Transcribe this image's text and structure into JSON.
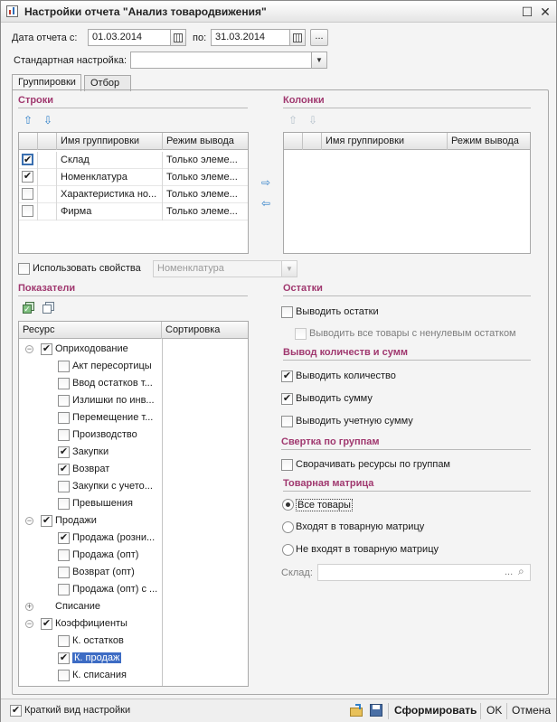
{
  "window": {
    "title": "Настройки отчета \"Анализ товародвижения\"",
    "maximize_glyph": "☐",
    "close_glyph": "✕"
  },
  "period": {
    "from_label": "Дата отчета с:",
    "from_value": "01.03.2014",
    "to_label": "по:",
    "to_value": "31.03.2014",
    "choose_label": "..."
  },
  "standard": {
    "label": "Стандартная настройка:",
    "value": ""
  },
  "tabs": [
    {
      "label": "Группировки"
    },
    {
      "label": "Отбор"
    }
  ],
  "rows_section": {
    "title": "Строки",
    "columns": [
      "Имя группировки",
      "Режим вывода"
    ],
    "items": [
      {
        "checked": "✔",
        "name": "Склад",
        "mode": "Только элеме..."
      },
      {
        "checked": "✔",
        "name": "Номенклатура",
        "mode": "Только элеме..."
      },
      {
        "checked": "",
        "name": "Характеристика но...",
        "mode": "Только элеме..."
      },
      {
        "checked": "",
        "name": "Фирма",
        "mode": "Только элеме..."
      }
    ]
  },
  "columns_section": {
    "title": "Колонки",
    "columns": [
      "Имя группировки",
      "Режим вывода"
    ]
  },
  "use_props": {
    "label": "Использовать свойства",
    "value": "Номенклатура"
  },
  "indicators": {
    "title": "Показатели",
    "columns": [
      "Ресурс",
      "Сортировка"
    ],
    "tree": [
      {
        "toggle": "−",
        "checked": "✔",
        "label": "Оприходование",
        "level": 0
      },
      {
        "checked": "",
        "label": "Акт пересортицы",
        "level": 1
      },
      {
        "checked": "",
        "label": "Ввод остатков т...",
        "level": 1
      },
      {
        "checked": "",
        "label": "Излишки по инв...",
        "level": 1
      },
      {
        "checked": "",
        "label": "Перемещение т...",
        "level": 1
      },
      {
        "checked": "",
        "label": "Производство",
        "level": 1
      },
      {
        "checked": "✔",
        "label": "Закупки",
        "level": 1
      },
      {
        "checked": "✔",
        "label": "Возврат",
        "level": 1
      },
      {
        "checked": "",
        "label": "Закупки с учето...",
        "level": 1
      },
      {
        "checked": "",
        "label": "Превышения",
        "level": 1
      },
      {
        "toggle": "−",
        "checked": "✔",
        "label": "Продажи",
        "level": 0
      },
      {
        "checked": "✔",
        "label": "Продажа (розни...",
        "level": 1
      },
      {
        "checked": "",
        "label": "Продажа (опт)",
        "level": 1
      },
      {
        "checked": "",
        "label": "Возврат (опт)",
        "level": 1
      },
      {
        "checked": "",
        "label": "Продажа (опт) с ...",
        "level": 1
      },
      {
        "toggle": "+",
        "label": "Списание",
        "level": 0
      },
      {
        "toggle": "−",
        "checked": "✔",
        "label": "Коэффициенты",
        "level": 0
      },
      {
        "checked": "",
        "label": "К. остатков",
        "level": 1
      },
      {
        "checked": "✔",
        "label": "К. продаж",
        "level": 1,
        "selected": true
      },
      {
        "checked": "",
        "label": "К. списания",
        "level": 1
      }
    ]
  },
  "balances": {
    "title": "Остатки",
    "show_balances": {
      "label": "Выводить остатки",
      "checked": ""
    },
    "show_all": {
      "label": "Выводить все товары с ненулевым остатком",
      "checked": ""
    }
  },
  "qty_sums": {
    "title": "Вывод количеств и сумм",
    "show_qty": {
      "label": "Выводить количество",
      "checked": "✔"
    },
    "show_sum": {
      "label": "Выводить сумму",
      "checked": "✔"
    },
    "show_acc_sum": {
      "label": "Выводить учетную сумму",
      "checked": ""
    }
  },
  "collapse": {
    "title": "Свертка по группам",
    "collapse_res": {
      "label": "Сворачивать ресурсы по группам",
      "checked": ""
    }
  },
  "matrix": {
    "title": "Товарная матрица",
    "options": [
      "Все товары",
      "Входят в товарную матрицу",
      "Не входят в товарную матрицу"
    ],
    "selected_index": 0,
    "warehouse_label": "Склад:",
    "warehouse_value": ""
  },
  "footer": {
    "short_view": {
      "label": "Краткий вид настройки",
      "checked": "✔"
    },
    "generate": "Сформировать",
    "ok": "OK",
    "cancel": "Отмена"
  },
  "colors": {
    "section_title": "#a0386f",
    "selection": "#3d6cc4",
    "arrow": "#2f7fc8"
  }
}
